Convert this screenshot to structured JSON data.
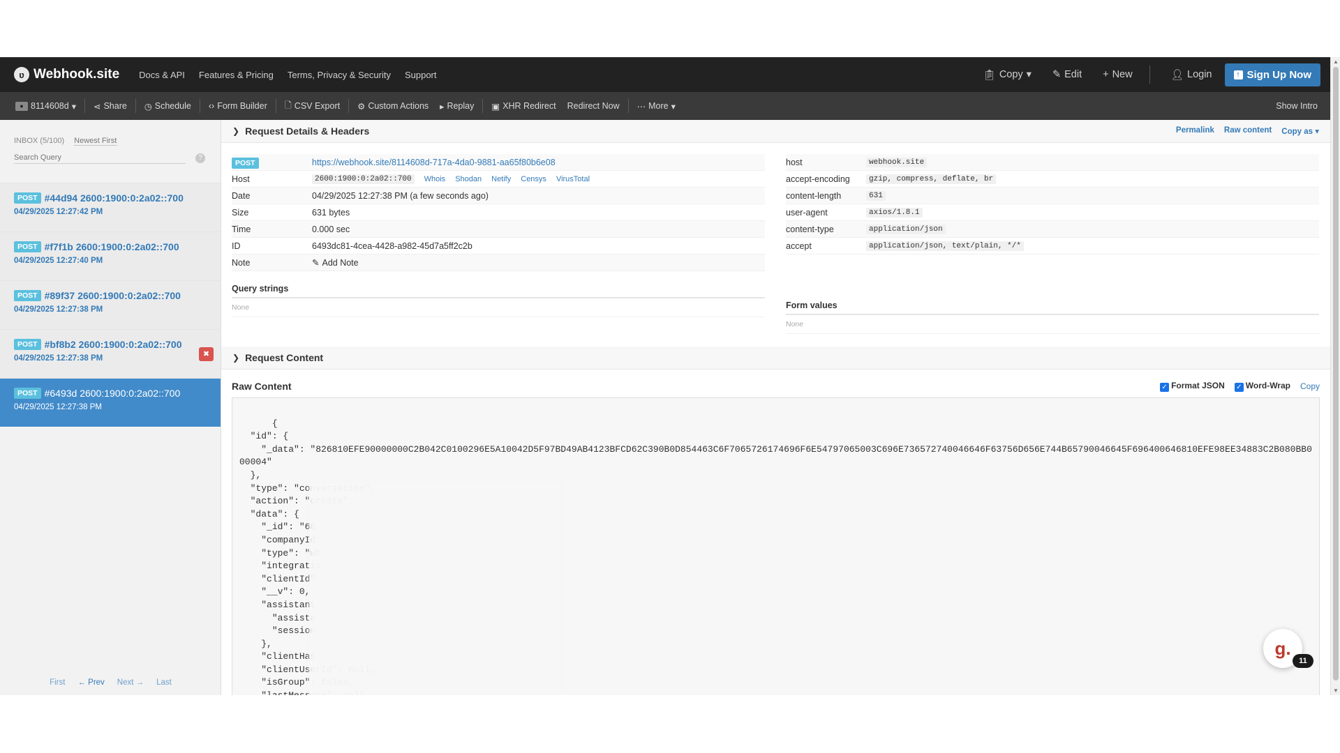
{
  "navbar": {
    "brand": "Webhook.site",
    "links": [
      "Docs & API",
      "Features & Pricing",
      "Terms, Privacy & Security",
      "Support"
    ],
    "copy": "Copy",
    "edit": "Edit",
    "new": "New",
    "login": "Login",
    "signup": "Sign Up Now"
  },
  "toolbar": {
    "token": "8114608d",
    "share": "Share",
    "schedule": "Schedule",
    "form_builder": "Form Builder",
    "csv_export": "CSV Export",
    "custom_actions": "Custom Actions",
    "replay": "Replay",
    "xhr_redirect": "XHR Redirect",
    "redirect_now": "Redirect Now",
    "more": "More",
    "show_intro": "Show Intro"
  },
  "sidebar": {
    "inbox": "INBOX (5/100)",
    "sort": "Newest First",
    "search_placeholder": "Search Query",
    "items": [
      {
        "method": "POST",
        "title": "#44d94 2600:1900:0:2a02::700",
        "date": "04/29/2025 12:27:42 PM"
      },
      {
        "method": "POST",
        "title": "#f7f1b 2600:1900:0:2a02::700",
        "date": "04/29/2025 12:27:40 PM"
      },
      {
        "method": "POST",
        "title": "#89f37 2600:1900:0:2a02::700",
        "date": "04/29/2025 12:27:38 PM"
      },
      {
        "method": "POST",
        "title": "#bf8b2 2600:1900:0:2a02::700",
        "date": "04/29/2025 12:27:38 PM"
      },
      {
        "method": "POST",
        "title": "#6493d 2600:1900:0:2a02::700",
        "date": "04/29/2025 12:27:38 PM"
      }
    ],
    "pager": {
      "first": "First",
      "prev": "← Prev",
      "next": "Next →",
      "last": "Last"
    }
  },
  "details": {
    "section_title": "Request Details & Headers",
    "permalink": "Permalink",
    "raw_content": "Raw content",
    "copy_as": "Copy as",
    "method": "POST",
    "url": "https://webhook.site/8114608d-717a-4da0-9881-aa65f80b6e08",
    "host_label": "Host",
    "host": "2600:1900:0:2a02::700",
    "host_links": [
      "Whois",
      "Shodan",
      "Netify",
      "Censys",
      "VirusTotal"
    ],
    "date_label": "Date",
    "date": "04/29/2025 12:27:38 PM (a few seconds ago)",
    "size_label": "Size",
    "size": "631 bytes",
    "time_label": "Time",
    "time": "0.000 sec",
    "id_label": "ID",
    "id": "6493dc81-4cea-4428-a982-45d7a5ff2c2b",
    "note_label": "Note",
    "add_note": "Add Note",
    "query_strings": "Query strings",
    "form_values": "Form values",
    "none": "None",
    "headers": [
      {
        "k": "host",
        "v": "webhook.site"
      },
      {
        "k": "accept-encoding",
        "v": "gzip, compress, deflate, br"
      },
      {
        "k": "content-length",
        "v": "631"
      },
      {
        "k": "user-agent",
        "v": "axios/1.8.1"
      },
      {
        "k": "content-type",
        "v": "application/json"
      },
      {
        "k": "accept",
        "v": "application/json, text/plain, */*"
      }
    ]
  },
  "content": {
    "section_title": "Request Content",
    "raw_title": "Raw Content",
    "format_json": "Format JSON",
    "word_wrap": "Word-Wrap",
    "copy": "Copy",
    "body": "{\n  \"id\": {\n    \"_data\": \"826810EFE90000000C2B042C0100296E5A10042D5F97BD49AB4123BFCD62C390B0D854463C6F7065726174696F6E54797065003C696E736572740046646F63756D656E744B65790046645F696400646810EFE98EE34883C2B080BB000004\"\n  },\n  \"type\": \"conversation\",\n  \"action\": \"create\",\n  \"data\": {\n    \"_id\": \"68\n    \"companyId\n    \"type\": \"wh\n    \"integratio\n    \"clientId\"\n    \"__v\": 0,\n    \"assistant\n      \"assista\n      \"session\n    },\n    \"clientHas\n    \"clientUserId\": null,\n    \"isGroup\": false,\n    \"lastMessage\": null\n  }\n}"
  },
  "chat": {
    "glyph": "g.",
    "count": "11"
  }
}
